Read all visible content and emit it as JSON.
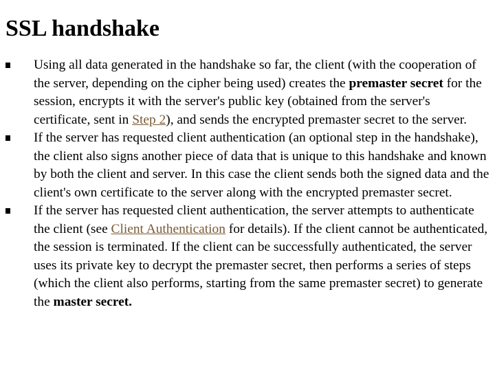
{
  "slide": {
    "title": "SSL handshake",
    "link_color": "#7a5a36",
    "bullets": [
      {
        "t1": "Using all data generated in the handshake so far, the client (with the cooperation of the server, depending on the cipher being used) creates the ",
        "b1": "premaster secret",
        "t2": " for the session, encrypts it with the server's public key (obtained from the server's certificate, sent in ",
        "link": "Step 2",
        "t3": "), and sends the encrypted premaster secret to the server."
      },
      {
        "t1": "If the server has requested client authentication (an optional step in the handshake), the client also signs another piece of data that is unique to this handshake and known by both the client and server. In this case the client sends both the signed data and the client's own certificate to the server along with the encrypted premaster secret."
      },
      {
        "t1": "If the server has requested client authentication, the server attempts to authenticate the client (see ",
        "link": "Client Authentication",
        "t2": " for details). If the client cannot be authenticated, the session is terminated. If the client can be successfully authenticated, the server uses its private key to decrypt the premaster secret, then performs a series of steps (which the client also performs, starting from the same premaster secret) to generate the ",
        "b1": "master secret."
      }
    ]
  }
}
